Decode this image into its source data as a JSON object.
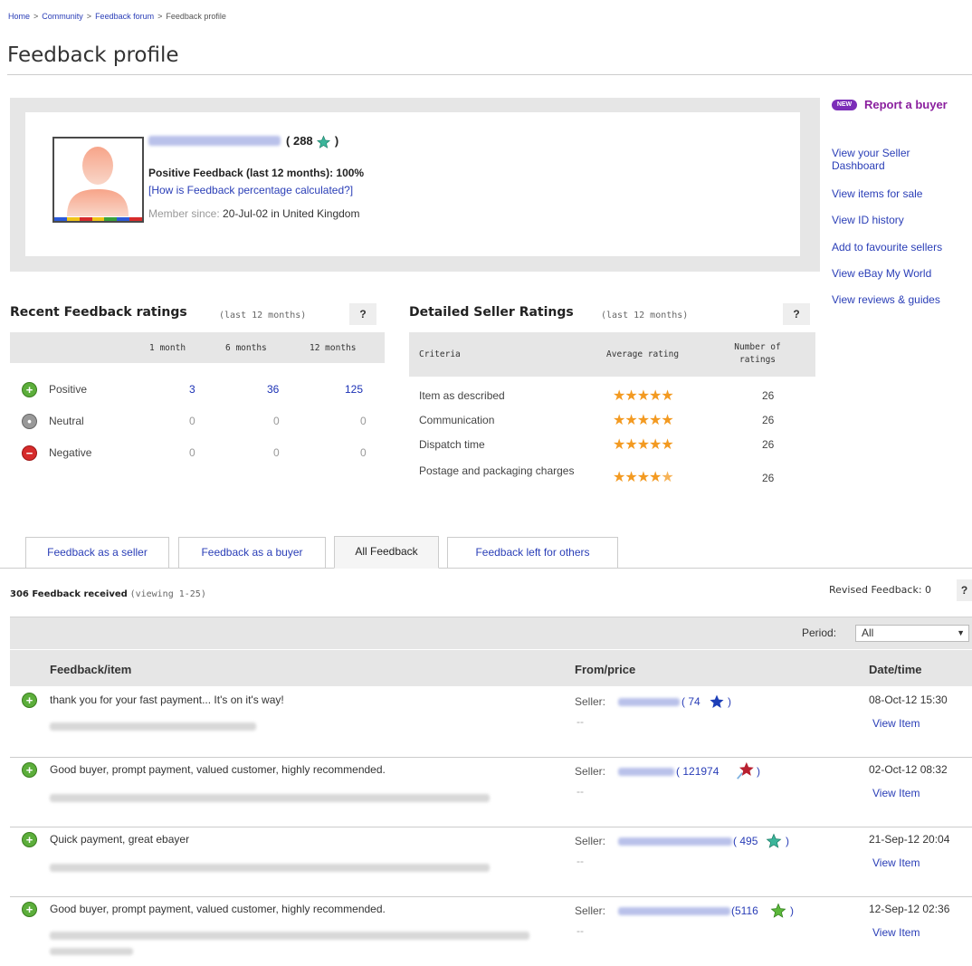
{
  "breadcrumb": [
    "Home",
    "Community",
    "Feedback forum",
    "Feedback profile"
  ],
  "breadcrumb_sep": ">",
  "page_title": "Feedback profile",
  "profile": {
    "score": "288",
    "score_open": "(",
    "score_close": ")",
    "positive_line": "Positive Feedback (last 12 months): 100%",
    "how_link": "[How is Feedback percentage calculated?]",
    "member_label": "Member since:",
    "member_value": "20-Jul-02 in United Kingdom"
  },
  "sidebar": {
    "new_badge": "NEW",
    "report_buyer": "Report a buyer",
    "links": [
      "View your Seller Dashboard",
      "View items for sale",
      "View ID history",
      "Add to favourite sellers",
      "View eBay My World",
      "View reviews & guides"
    ]
  },
  "recent_ratings": {
    "title": "Recent Feedback ratings",
    "subtitle": "(last 12 months)",
    "help": "?",
    "columns": [
      "1 month",
      "6 months",
      "12 months"
    ],
    "rows": [
      {
        "label": "Positive",
        "values": [
          "3",
          "36",
          "125"
        ]
      },
      {
        "label": "Neutral",
        "values": [
          "0",
          "0",
          "0"
        ]
      },
      {
        "label": "Negative",
        "values": [
          "0",
          "0",
          "0"
        ]
      }
    ]
  },
  "detailed_ratings": {
    "title": "Detailed Seller Ratings",
    "subtitle": "(last 12 months)",
    "help": "?",
    "columns": [
      "Criteria",
      "Average rating",
      "Number of ratings"
    ],
    "rows": [
      {
        "criteria": "Item as described",
        "stars": 5,
        "count": "26"
      },
      {
        "criteria": "Communication",
        "stars": 5,
        "count": "26"
      },
      {
        "criteria": "Dispatch time",
        "stars": 5,
        "count": "26"
      },
      {
        "criteria": "Postage and packaging charges",
        "stars": 4.5,
        "count": "26"
      }
    ],
    "star_color": "#f39a21"
  },
  "tabs": [
    {
      "label": "Feedback as a seller",
      "active": false
    },
    {
      "label": "Feedback as a buyer",
      "active": false
    },
    {
      "label": "All Feedback",
      "active": true
    },
    {
      "label": "Feedback left for others",
      "active": false
    }
  ],
  "feedback_count": {
    "text": "306 Feedback received",
    "viewing": "(viewing 1-25)"
  },
  "revised": {
    "label": "Revised Feedback: 0",
    "help": "?"
  },
  "period": {
    "label": "Period:",
    "value": "All"
  },
  "list_columns": [
    "Feedback/item",
    "From/price",
    "Date/time"
  ],
  "feedback": [
    {
      "comment": "thank you for your fast payment... It's on it's way!",
      "role": "Seller:",
      "score": "74",
      "star_color": "#1d3fb8",
      "price": "--",
      "date": "08-Oct-12 15:30",
      "view": "View Item"
    },
    {
      "comment": "Good buyer, prompt payment, valued customer, highly recommended.",
      "role": "Seller:",
      "score": "121974",
      "star_color": "#b82030",
      "price": "--",
      "date": "02-Oct-12 08:32",
      "view": "View Item"
    },
    {
      "comment": "Quick payment, great ebayer",
      "role": "Seller:",
      "score": "495",
      "star_color": "#3bb59a",
      "price": "--",
      "date": "21-Sep-12 20:04",
      "view": "View Item"
    },
    {
      "comment": "Good buyer, prompt payment, valued customer, highly recommended.",
      "role": "Seller:",
      "score": "5116",
      "star_color": "#5cb83b",
      "price": "--",
      "date": "12-Sep-12 02:36",
      "view": "View Item"
    }
  ],
  "colors": {
    "link": "#2a3eb7",
    "report": "#8a1f9e",
    "positive": "#5cae3b",
    "negative": "#d62b2b",
    "neutral": "#999999",
    "profile_star": "#3bb59a"
  }
}
